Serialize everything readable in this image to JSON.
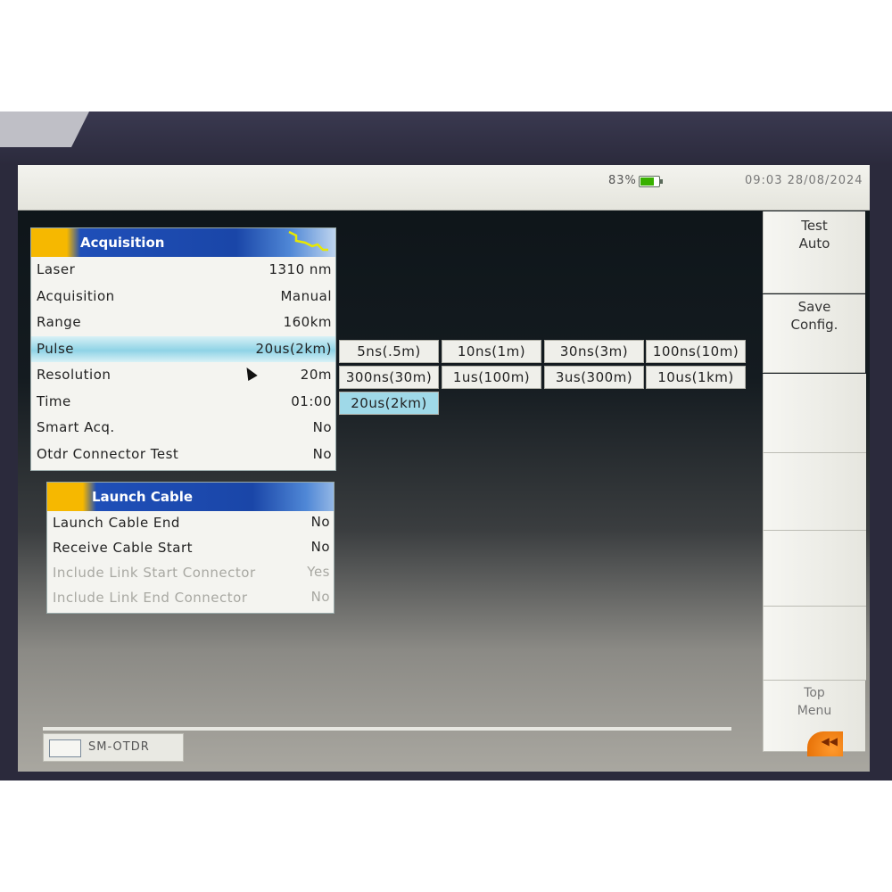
{
  "status_bar": {
    "battery_percent": "83%",
    "clock": "09:03  28/08/2024",
    "battery_color": "#38b000"
  },
  "softkeys": {
    "test": "Test\nAuto",
    "save": "Save\nConfig.",
    "top_menu": "Top\nMenu"
  },
  "acquisition": {
    "title": "Acquisition",
    "rows": [
      {
        "label": "Laser",
        "value": "1310 nm"
      },
      {
        "label": "Acquisition",
        "value": "Manual"
      },
      {
        "label": "Range",
        "value": "160km"
      },
      {
        "label": "Pulse",
        "value": "20us(2km)"
      },
      {
        "label": "Resolution",
        "value": "20m"
      },
      {
        "label": "Time",
        "value": "01:00"
      },
      {
        "label": "Smart Acq.",
        "value": "No"
      },
      {
        "label": "Otdr Connector Test",
        "value": "No"
      }
    ]
  },
  "pulse_options": [
    "5ns(.5m)",
    "10ns(1m)",
    "30ns(3m)",
    "100ns(10m)",
    "300ns(30m)",
    "1us(100m)",
    "3us(300m)",
    "10us(1km)",
    "20us(2km)"
  ],
  "launch_cable": {
    "title": "Launch Cable",
    "rows": [
      {
        "label": "Launch Cable End",
        "value": "No"
      },
      {
        "label": "Receive Cable Start",
        "value": "No"
      },
      {
        "label": "Include Link Start Connector",
        "value": "Yes"
      },
      {
        "label": "Include Link End Connector",
        "value": "No"
      }
    ]
  },
  "bottom_tab": {
    "label": "SM-OTDR"
  },
  "colors": {
    "header_blue": "#1f4fb8",
    "header_accent": "#f6b800",
    "selection": "#8fd3e6"
  }
}
